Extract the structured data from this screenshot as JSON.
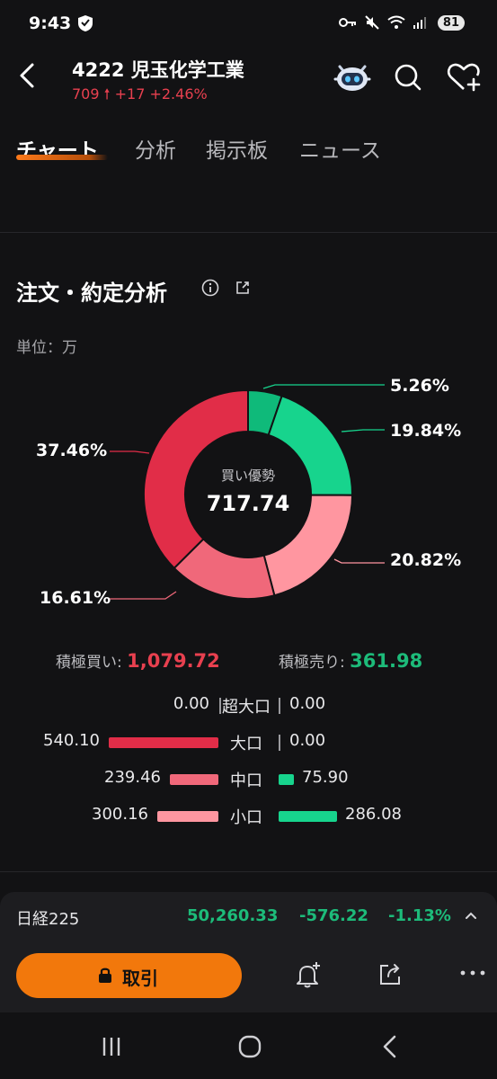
{
  "status_bar": {
    "time": "9:43",
    "battery": "81"
  },
  "header": {
    "title": "4222  児玉化学工業",
    "price": "709",
    "change": "+17",
    "change_pct": "+2.46%"
  },
  "tabs": [
    {
      "label": "チャート",
      "active": true
    },
    {
      "label": "分析",
      "active": false
    },
    {
      "label": "掲示板",
      "active": false
    },
    {
      "label": "ニュース",
      "active": false
    }
  ],
  "section": {
    "title": "注文・約定分析",
    "unit": "単位：万"
  },
  "chart_data": {
    "type": "pie",
    "center_label": "買い優勢",
    "center_value": "717.74",
    "slices": [
      {
        "label": "5.26%",
        "value": 5.26,
        "color": "#0fba7a"
      },
      {
        "label": "19.84%",
        "value": 19.84,
        "color": "#17d48d"
      },
      {
        "label": "20.82%",
        "value": 20.82,
        "color": "#ff96a0"
      },
      {
        "label": "16.61%",
        "value": 16.61,
        "color": "#f0687a"
      },
      {
        "label": "37.46%",
        "value": 37.46,
        "color": "#e12d48"
      }
    ]
  },
  "totals": {
    "buy_label": "積極買い:",
    "buy_value": "1,079.72",
    "sell_label": "積極売り:",
    "sell_value": "361.98"
  },
  "breakdown": [
    {
      "label": "超大口",
      "buy": "0.00",
      "buy_value": 0.0,
      "sell": "0.00",
      "sell_value": 0.0,
      "buy_color": "#e12d48"
    },
    {
      "label": "大口",
      "buy": "540.10",
      "buy_value": 540.1,
      "sell": "0.00",
      "sell_value": 0.0,
      "buy_color": "#e12d48"
    },
    {
      "label": "中口",
      "buy": "239.46",
      "buy_value": 239.46,
      "sell": "75.90",
      "sell_value": 75.9,
      "buy_color": "#f0687a"
    },
    {
      "label": "小口",
      "buy": "300.16",
      "buy_value": 300.16,
      "sell": "286.08",
      "sell_value": 286.08,
      "buy_color": "#ff96a0"
    }
  ],
  "index_bar": {
    "name": "日経225",
    "value": "50,260.33",
    "change": "-576.22",
    "change_pct": "-1.13%"
  },
  "trade_button": {
    "label": "取引"
  },
  "colors": {
    "accent": "#f2780c",
    "up": "#e8404f",
    "down": "#1dbb7a"
  }
}
